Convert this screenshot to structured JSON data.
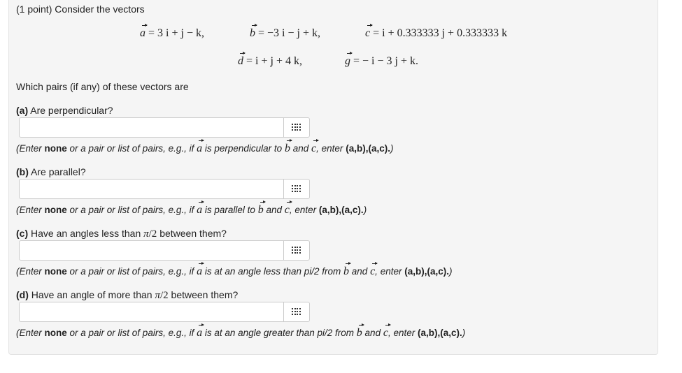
{
  "intro": {
    "points": "(1 point)",
    "text": "Consider the vectors"
  },
  "vectors": {
    "a": {
      "name": "a",
      "rhs": "3 i + j − k,"
    },
    "b": {
      "name": "b",
      "rhs": "−3 i − j + k,"
    },
    "c": {
      "name": "c",
      "rhs": "i + 0.333333 j + 0.333333 k"
    },
    "d": {
      "name": "d",
      "rhs": "i + j + 4 k,"
    },
    "g": {
      "name": "g",
      "rhs": "− i − 3 j + k."
    }
  },
  "question": "Which pairs (if any) of these vectors are",
  "parts": [
    {
      "letter": "(a)",
      "prompt": "Are perpendicular?",
      "value": "",
      "hint_pre": "(Enter ",
      "hint_none": "none",
      "hint_mid": " or a pair or list of pairs, e.g., if",
      "hint_rel": "is perpendicular to",
      "hint_and": "and",
      "hint_enter": "enter",
      "hint_example": "(a,b),(a,c).",
      "hint_close": ")"
    },
    {
      "letter": "(b)",
      "prompt": "Are parallel?",
      "value": "",
      "hint_pre": "(Enter ",
      "hint_none": "none",
      "hint_mid": " or a pair or list of pairs, e.g., if",
      "hint_rel": "is parallel to",
      "hint_and": "and",
      "hint_enter": "enter",
      "hint_example": "(a,b),(a,c).",
      "hint_close": ")"
    },
    {
      "letter": "(c)",
      "prompt_pre": "Have an angles less than",
      "prompt_post": "between them?",
      "value": "",
      "hint_pre": "(Enter ",
      "hint_none": "none",
      "hint_mid": " or a pair or list of pairs, e.g., if",
      "hint_rel": "is at an angle less than pi/2 from",
      "hint_and": "and",
      "hint_enter": "enter",
      "hint_example": "(a,b),(a,c).",
      "hint_close": ")"
    },
    {
      "letter": "(d)",
      "prompt_pre": "Have an angle of more than",
      "prompt_post": "between them?",
      "value": "",
      "hint_pre": "(Enter ",
      "hint_none": "none",
      "hint_mid": " or a pair or list of pairs, e.g., if",
      "hint_rel": "is at an angle greater than pi/2 from",
      "hint_and": "and",
      "hint_enter": "enter",
      "hint_example": "(a,b),(a,c).",
      "hint_close": ")"
    }
  ],
  "pi_symbol": "π",
  "pi_denominator": "/2",
  "icons": {
    "answer_helper": "grid-icon"
  },
  "colors": {
    "panel_bg": "#f5f5f5",
    "text": "#222222",
    "input_border": "#cccccc"
  }
}
